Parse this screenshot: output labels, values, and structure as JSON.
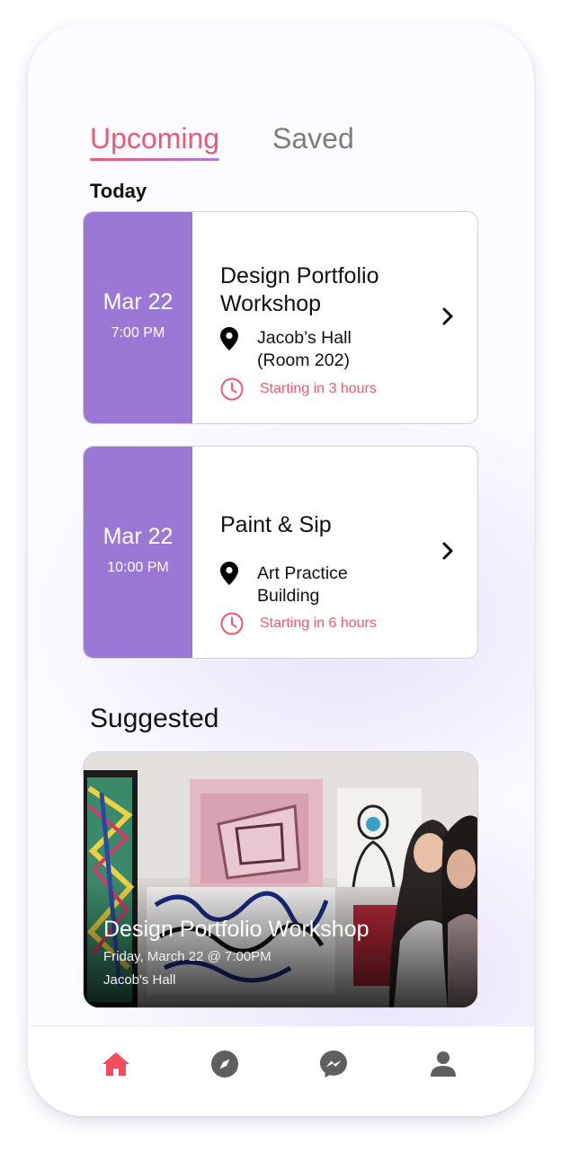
{
  "tabs": {
    "upcoming": "Upcoming",
    "saved": "Saved",
    "active": "upcoming"
  },
  "sections": {
    "today": "Today",
    "suggested": "Suggested"
  },
  "events": [
    {
      "date": "Mar 22",
      "time": "7:00 PM",
      "title": "Design Portfolio Workshop",
      "location": "Jacob’s Hall (Room 202)",
      "starting": "Starting in 3 hours"
    },
    {
      "date": "Mar 22",
      "time": "10:00 PM",
      "title": "Paint & Sip",
      "location": "Art Practice Building",
      "starting": "Starting in 6 hours"
    }
  ],
  "suggested": {
    "title": "Design Portfolio Workshop",
    "datetime": "Friday, March 22 @ 7:00PM",
    "location": "Jacob's Hall"
  },
  "nav": {
    "items": [
      {
        "icon": "home-icon",
        "active": true
      },
      {
        "icon": "compass-icon",
        "active": false
      },
      {
        "icon": "messenger-icon",
        "active": false
      },
      {
        "icon": "user-icon",
        "active": false
      }
    ]
  },
  "colors": {
    "accent": "#e85a75",
    "date_block": "#9b78d6",
    "tab_inactive": "#7d7d7d",
    "nav_inactive": "#5f5f5f",
    "nav_active": "#f04e5f"
  }
}
